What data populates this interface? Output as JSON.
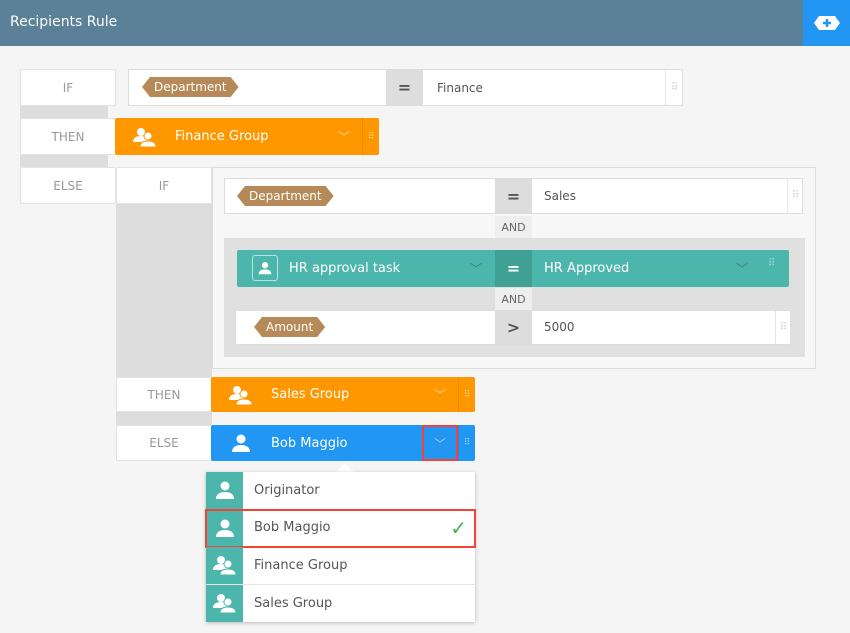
{
  "header": {
    "title": "Recipients Rule",
    "add_icon": "add-icon"
  },
  "rule": {
    "if_label": "IF",
    "then_label": "THEN",
    "else_label": "ELSE",
    "condition": {
      "field": "Department",
      "operator": "=",
      "value": "Finance"
    },
    "then_recipient": "Finance Group",
    "else": {
      "if_label": "IF",
      "conditions": [
        {
          "field": "Department",
          "operator": "=",
          "value": "Sales"
        },
        {
          "connector": "AND"
        },
        {
          "field": "HR approval task",
          "operator": "=",
          "value": "HR Approved"
        },
        {
          "connector": "AND"
        },
        {
          "field": "Amount",
          "operator": ">",
          "value": "5000"
        }
      ],
      "then_label": "THEN",
      "then_recipient": "Sales Group",
      "else_label": "ELSE",
      "else_recipient": "Bob Maggio"
    }
  },
  "dropdown": {
    "items": [
      {
        "label": "Originator",
        "icon": "user-icon",
        "selected": false
      },
      {
        "label": "Bob Maggio",
        "icon": "user-icon",
        "selected": true
      },
      {
        "label": "Finance Group",
        "icon": "group-icon",
        "selected": false
      },
      {
        "label": "Sales Group",
        "icon": "group-icon",
        "selected": false
      }
    ]
  },
  "colors": {
    "header": "#5a8197",
    "accent": "#2196f3",
    "group": "#ff9800",
    "task": "#4db6ac",
    "tag": "#b58a58"
  }
}
